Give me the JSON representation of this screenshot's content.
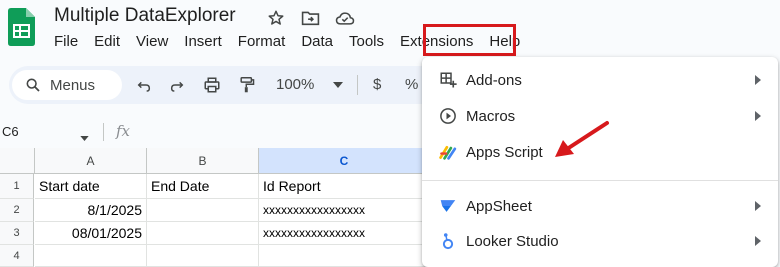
{
  "document": {
    "title": "Multiple DataExplorer"
  },
  "menubar": {
    "items": [
      {
        "id": "file",
        "label": "File"
      },
      {
        "id": "edit",
        "label": "Edit"
      },
      {
        "id": "view",
        "label": "View"
      },
      {
        "id": "insert",
        "label": "Insert"
      },
      {
        "id": "format",
        "label": "Format"
      },
      {
        "id": "data",
        "label": "Data"
      },
      {
        "id": "tools",
        "label": "Tools"
      },
      {
        "id": "extensions",
        "label": "Extensions",
        "highlighted": true
      },
      {
        "id": "help",
        "label": "Help"
      }
    ]
  },
  "toolbar": {
    "search_label": "Menus",
    "zoom": "100%",
    "currency": "$",
    "percent": "%",
    "icons": [
      "search-icon",
      "undo-icon",
      "redo-icon",
      "print-icon",
      "paint-format-icon",
      "dropdown-caret-icon"
    ]
  },
  "formula_bar": {
    "name_box": "C6",
    "fx": "fx"
  },
  "grid": {
    "columns": [
      "A",
      "B",
      "C"
    ],
    "selected_column": "C",
    "rows": [
      {
        "row": "1",
        "cells": [
          "Start date",
          "End Date",
          "Id Report"
        ]
      },
      {
        "row": "2",
        "cells": [
          "8/1/2025",
          "",
          "xxxxxxxxxxxxxxxxx"
        ]
      },
      {
        "row": "3",
        "cells": [
          "08/01/2025",
          "",
          "xxxxxxxxxxxxxxxxx"
        ]
      },
      {
        "row": "4",
        "cells": [
          "",
          "",
          ""
        ]
      }
    ]
  },
  "extensions_menu": {
    "items": [
      {
        "label": "Add-ons",
        "icon": "add-ons-icon",
        "has_submenu": true
      },
      {
        "label": "Macros",
        "icon": "macros-play-icon",
        "has_submenu": true
      },
      {
        "label": "Apps Script",
        "icon": "apps-script-icon",
        "has_submenu": false
      },
      {
        "label": "AppSheet",
        "icon": "appsheet-icon",
        "has_submenu": true
      },
      {
        "label": "Looker Studio",
        "icon": "looker-studio-icon",
        "has_submenu": true
      }
    ]
  },
  "colors": {
    "sheets_green": "#0f9d58",
    "annotation_red": "#d7191c",
    "selected_column": "#d3e3fd",
    "toolbar_bg": "#edf2fa"
  }
}
